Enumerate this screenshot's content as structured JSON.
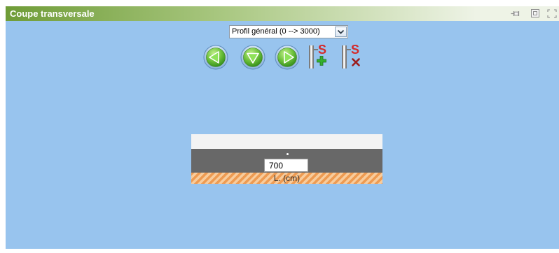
{
  "window": {
    "title": "Coupe transversale",
    "controls": [
      {
        "icon": "pin-icon"
      },
      {
        "icon": "window-icon"
      },
      {
        "icon": "maximize-icon"
      }
    ]
  },
  "profile_select": {
    "selected": "Profil général (0 --> 3000)",
    "icon": "chevron-down-icon"
  },
  "toolbar": {
    "previous": {
      "icon": "arrow-left-icon"
    },
    "down": {
      "icon": "arrow-down-icon"
    },
    "next": {
      "icon": "arrow-right-icon"
    },
    "add_section": {
      "icon": "section-add-icon",
      "letter": "S"
    },
    "delete_section": {
      "icon": "section-delete-icon",
      "letter": "S"
    }
  },
  "cross_section": {
    "width_value": "700",
    "width_label": "L. (cm)"
  },
  "colors": {
    "panel_background": "#98c4ee",
    "title_bar_start": "#6f9c37",
    "title_bar_mid": "#aac882",
    "title_bar_end": "#eef3e6",
    "title_text": "#ffffff",
    "surface_layer": "#f3f3f3",
    "road_layer": "#686868",
    "hatch_dark": "#ee9b52",
    "hatch_light": "#f8cc9c",
    "section_red": "#d42a2a",
    "add_green": "#33b02e",
    "delete_red": "#9b1c1c"
  }
}
